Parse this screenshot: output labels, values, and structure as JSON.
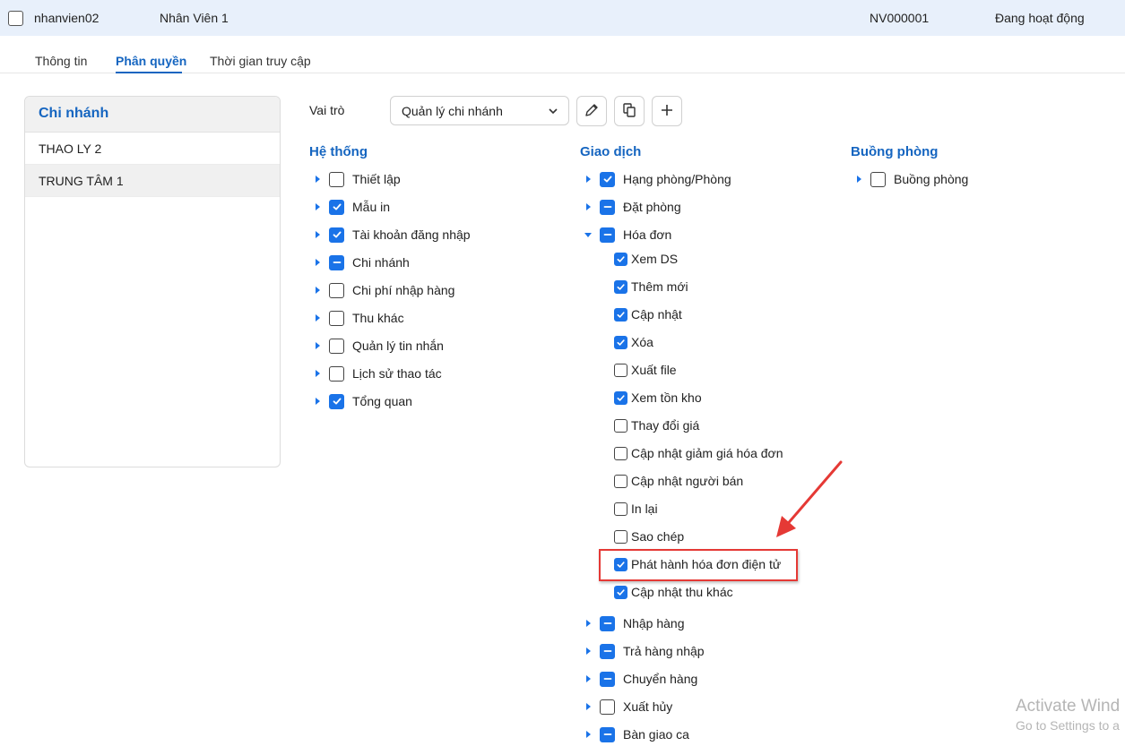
{
  "user_row": {
    "username": "nhanvien02",
    "name": "Nhân Viên 1",
    "code": "NV000001",
    "status": "Đang hoạt động"
  },
  "tabs": [
    {
      "label": "Thông tin",
      "active": false
    },
    {
      "label": "Phân quyền",
      "active": true
    },
    {
      "label": "Thời gian truy cập",
      "active": false
    }
  ],
  "branches": {
    "title": "Chi nhánh",
    "items": [
      {
        "label": "THAO LY 2",
        "selected": false
      },
      {
        "label": "TRUNG TÂM 1",
        "selected": true
      }
    ]
  },
  "role": {
    "label": "Vai trò",
    "value": "Quản lý chi nhánh",
    "buttons": [
      "edit-icon",
      "copy-icon",
      "plus-icon"
    ]
  },
  "columns": {
    "system": {
      "title": "Hệ thống",
      "items": [
        {
          "label": "Thiết lập",
          "state": "unchecked"
        },
        {
          "label": "Mẫu in",
          "state": "checked"
        },
        {
          "label": "Tài khoản đăng nhập",
          "state": "checked"
        },
        {
          "label": "Chi nhánh",
          "state": "partial"
        },
        {
          "label": "Chi phí nhập hàng",
          "state": "unchecked"
        },
        {
          "label": "Thu khác",
          "state": "unchecked"
        },
        {
          "label": "Quản lý tin nhắn",
          "state": "unchecked"
        },
        {
          "label": "Lịch sử thao tác",
          "state": "unchecked"
        },
        {
          "label": "Tổng quan",
          "state": "checked"
        }
      ]
    },
    "transactions": {
      "title": "Giao dịch",
      "items": [
        {
          "label": "Hạng phòng/Phòng",
          "state": "checked"
        },
        {
          "label": "Đặt phòng",
          "state": "partial"
        },
        {
          "label": "Hóa đơn",
          "state": "partial",
          "expanded": true
        }
      ],
      "invoice_children": [
        {
          "label": "Xem DS",
          "state": "checked"
        },
        {
          "label": "Thêm mới",
          "state": "checked"
        },
        {
          "label": "Cập nhật",
          "state": "checked"
        },
        {
          "label": "Xóa",
          "state": "checked"
        },
        {
          "label": "Xuất file",
          "state": "unchecked"
        },
        {
          "label": "Xem tồn kho",
          "state": "checked"
        },
        {
          "label": "Thay đổi giá",
          "state": "unchecked"
        },
        {
          "label": "Cập nhật giảm giá hóa đơn",
          "state": "unchecked"
        },
        {
          "label": "Cập nhật người bán",
          "state": "unchecked"
        },
        {
          "label": "In lại",
          "state": "unchecked"
        },
        {
          "label": "Sao chép",
          "state": "unchecked"
        },
        {
          "label": "Phát hành hóa đơn điện tử",
          "state": "checked"
        },
        {
          "label": "Cập nhật thu khác",
          "state": "checked"
        }
      ],
      "after": [
        {
          "label": "Nhập hàng",
          "state": "partial"
        },
        {
          "label": "Trả hàng nhập",
          "state": "partial"
        },
        {
          "label": "Chuyển hàng",
          "state": "partial"
        },
        {
          "label": "Xuất hủy",
          "state": "unchecked"
        },
        {
          "label": "Bàn giao ca",
          "state": "partial"
        }
      ]
    },
    "housekeeping": {
      "title": "Buồng phòng",
      "items": [
        {
          "label": "Buồng phòng",
          "state": "unchecked"
        }
      ]
    }
  },
  "watermark": {
    "line1": "Activate Wind",
    "line2": "Go to Settings to a"
  },
  "colors": {
    "accent": "#1565c0",
    "checkbox": "#1a73e8",
    "highlight": "#e53935",
    "header_bg": "#e8f0fb"
  }
}
